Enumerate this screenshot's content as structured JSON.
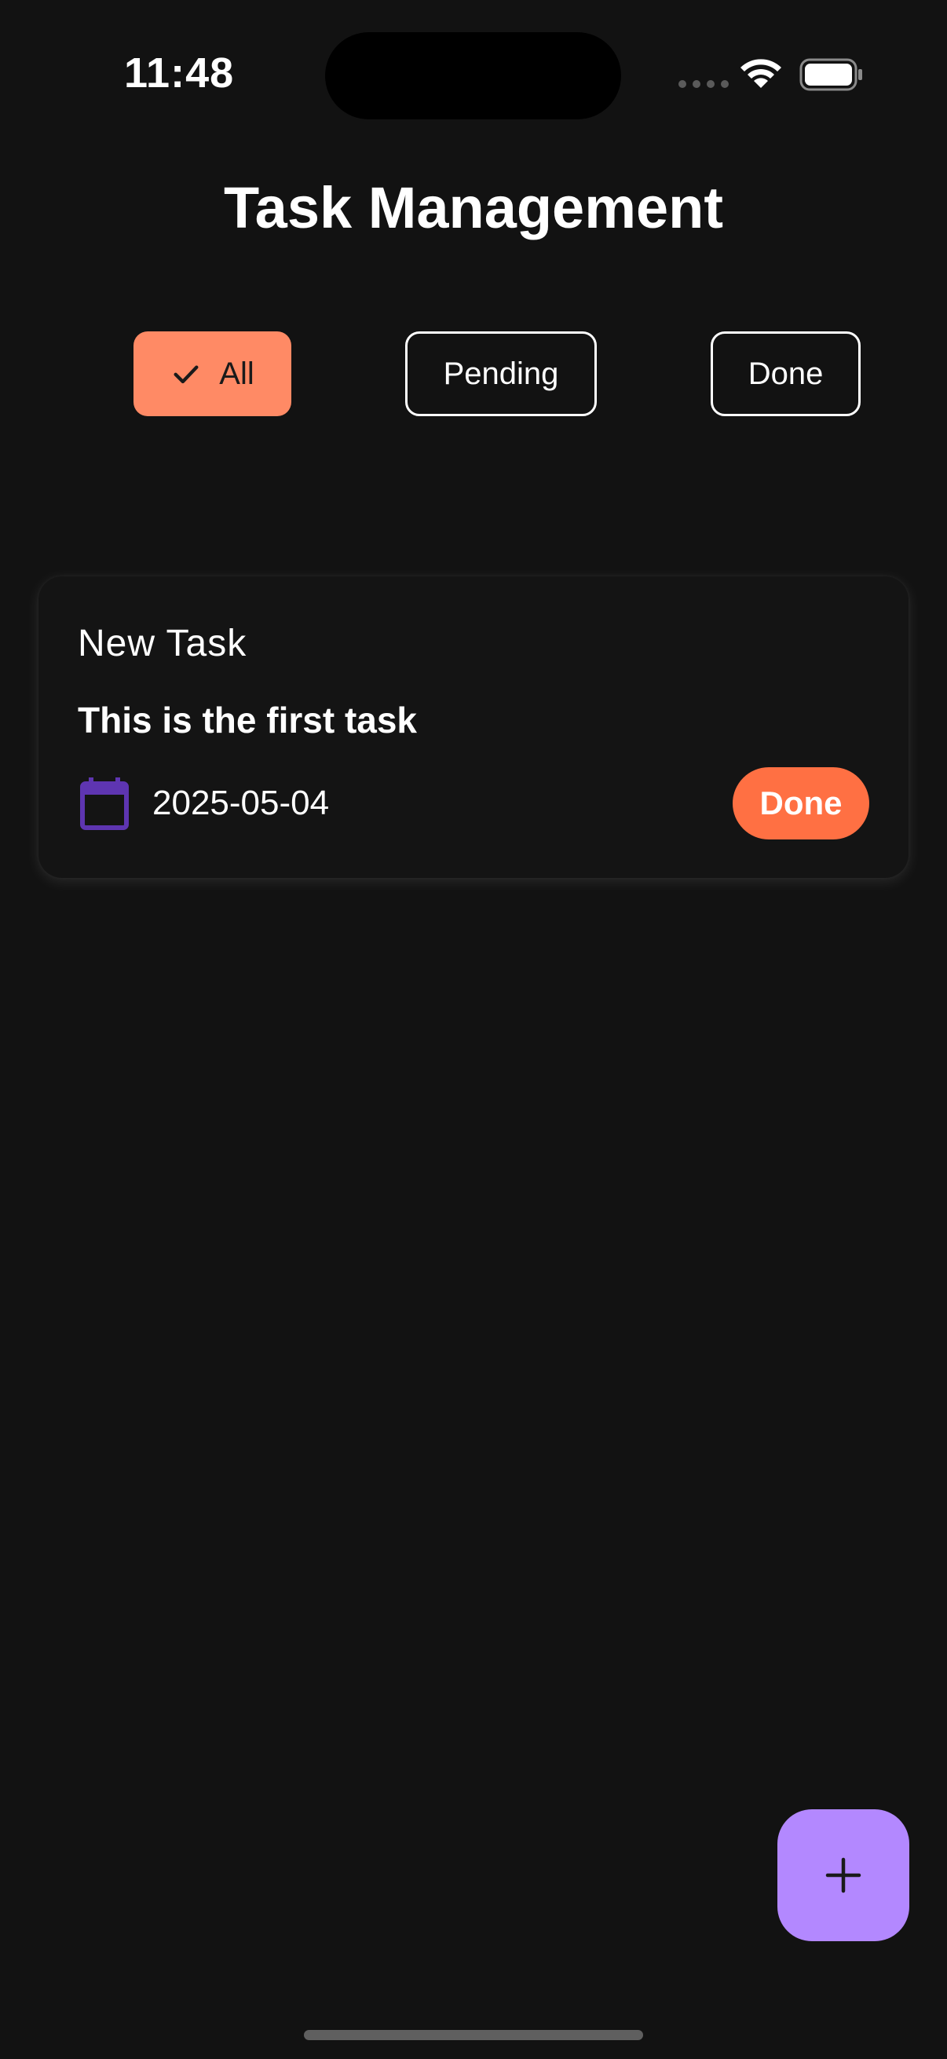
{
  "status_bar": {
    "time": "11:48",
    "icons": [
      "signal-dots-icon",
      "wifi-icon",
      "battery-icon"
    ]
  },
  "header": {
    "title": "Task Management"
  },
  "filters": {
    "selected": "All",
    "items": [
      {
        "label": "All",
        "selected": true,
        "icon": "check-icon"
      },
      {
        "label": "Pending",
        "selected": false
      },
      {
        "label": "Done",
        "selected": false
      }
    ]
  },
  "tasks": [
    {
      "title": "New Task",
      "description": "This is the first task",
      "date": "2025-05-04",
      "date_icon": "calendar-icon",
      "action_label": "Done"
    }
  ],
  "fab": {
    "icon": "plus-icon"
  },
  "colors": {
    "background": "#121212",
    "accent_chip": "#FF8A65",
    "done_button": "#FF7043",
    "fab": "#B388FF",
    "calendar": "#5E35B1"
  }
}
